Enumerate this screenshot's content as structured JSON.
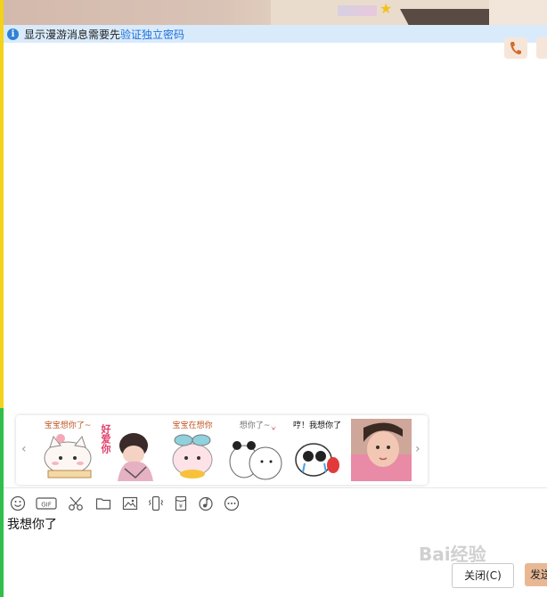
{
  "notice": {
    "text": "显示漫游消息需要先",
    "link": "验证独立密码"
  },
  "stickers": {
    "captions": [
      "宝宝想你了~",
      "好爱你",
      "宝宝在想你",
      "想你了~",
      "哼！我想你了",
      ""
    ]
  },
  "input": {
    "text": "我想你了"
  },
  "buttons": {
    "close_label": "关闭(C)",
    "send_label": "发送"
  },
  "toolbar": {
    "icons": [
      "emoji-icon",
      "gif-icon",
      "scissors-icon",
      "folder-icon",
      "image-icon",
      "vibrate-icon",
      "red-packet-icon",
      "music-icon",
      "more-icon"
    ]
  },
  "watermark": "Bai经验",
  "colors": {
    "notice_bg": "#d9ebfb",
    "link": "#1e6fd9",
    "send_button": "#e8b895",
    "left_top_bar": "#f2d21a",
    "left_bottom_bar": "#2fbf4a"
  }
}
